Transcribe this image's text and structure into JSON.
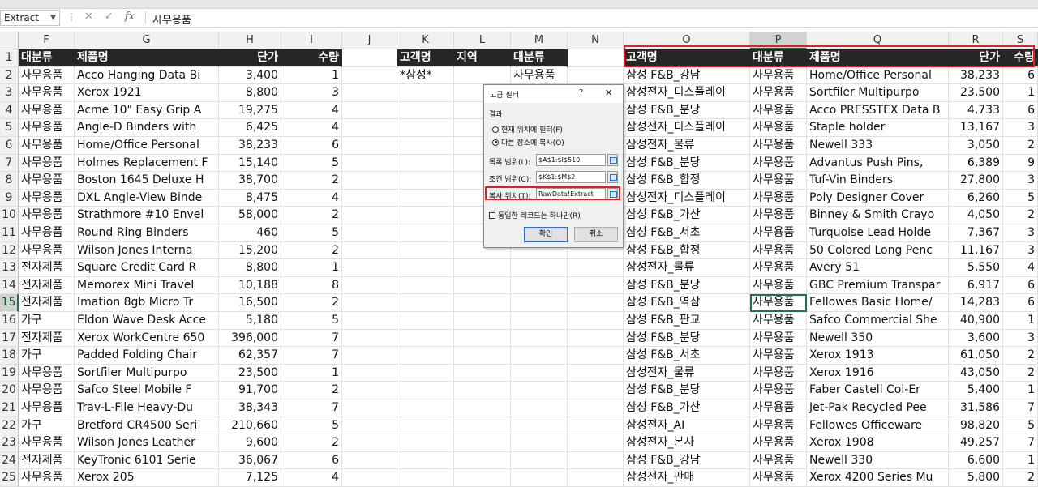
{
  "formula_bar": {
    "name_box": "Extract",
    "formula_value": "사무용품",
    "fx_label": "fx"
  },
  "columns": [
    {
      "letter": "F"
    },
    {
      "letter": "G"
    },
    {
      "letter": "H"
    },
    {
      "letter": "I"
    },
    {
      "letter": "J"
    },
    {
      "letter": "K"
    },
    {
      "letter": "L"
    },
    {
      "letter": "M"
    },
    {
      "letter": "N"
    },
    {
      "letter": "O"
    },
    {
      "letter": "P"
    },
    {
      "letter": "Q"
    },
    {
      "letter": "R"
    },
    {
      "letter": "S"
    }
  ],
  "rows": [
    "1",
    "2",
    "3",
    "4",
    "5",
    "6",
    "7",
    "8",
    "9",
    "10",
    "11",
    "12",
    "13",
    "14",
    "15",
    "16",
    "17",
    "18",
    "19",
    "20",
    "21",
    "22",
    "23",
    "24",
    "25"
  ],
  "source_headers": [
    "대분류",
    "제품명",
    "단가",
    "수량"
  ],
  "source_rows": [
    [
      "사무용품",
      "Acco Hanging Data Bi",
      "3,400",
      "1"
    ],
    [
      "사무용품",
      "Xerox 1921",
      "8,800",
      "3"
    ],
    [
      "사무용품",
      "Acme 10\" Easy Grip A",
      "19,275",
      "4"
    ],
    [
      "사무용품",
      "Angle-D Binders with",
      "6,425",
      "4"
    ],
    [
      "사무용품",
      "Home/Office Personal",
      "38,233",
      "6"
    ],
    [
      "사무용품",
      "Holmes Replacement F",
      "15,140",
      "5"
    ],
    [
      "사무용품",
      "Boston 1645 Deluxe H",
      "38,700",
      "2"
    ],
    [
      "사무용품",
      "DXL Angle-View Binde",
      "8,475",
      "4"
    ],
    [
      "사무용품",
      "Strathmore #10 Envel",
      "58,000",
      "2"
    ],
    [
      "사무용품",
      "Round Ring Binders",
      "460",
      "5"
    ],
    [
      "사무용품",
      "Wilson Jones Interna",
      "15,200",
      "2"
    ],
    [
      "전자제품",
      "Square Credit Card R",
      "8,800",
      "1"
    ],
    [
      "전자제품",
      "Memorex Mini Travel",
      "10,188",
      "8"
    ],
    [
      "전자제품",
      "Imation 8gb Micro Tr",
      "16,500",
      "2"
    ],
    [
      "가구",
      "Eldon Wave Desk Acce",
      "5,180",
      "5"
    ],
    [
      "전자제품",
      "Xerox WorkCentre 650",
      "396,000",
      "7"
    ],
    [
      "가구",
      "Padded Folding Chair",
      "62,357",
      "7"
    ],
    [
      "사무용품",
      "Sortfiler Multipurpo",
      "23,500",
      "1"
    ],
    [
      "사무용품",
      "Safco Steel Mobile F",
      "91,700",
      "2"
    ],
    [
      "사무용품",
      "Trav-L-File Heavy-Du",
      "38,343",
      "7"
    ],
    [
      "가구",
      "Bretford CR4500 Seri",
      "210,660",
      "5"
    ],
    [
      "사무용품",
      "Wilson Jones Leather",
      "9,600",
      "2"
    ],
    [
      "전자제품",
      "KeyTronic 6101 Serie",
      "36,067",
      "6"
    ],
    [
      "사무용품",
      "Xerox 205",
      "7,125",
      "4"
    ]
  ],
  "criteria": {
    "headers": [
      "고객명",
      "지역",
      "대분류"
    ],
    "values": [
      "*삼성*",
      "",
      "사무용품"
    ]
  },
  "extract_headers": [
    "고객명",
    "대분류",
    "제품명",
    "단가",
    "수량"
  ],
  "extract_rows": [
    [
      "삼성 F&B_강남",
      "사무용품",
      "Home/Office Personal",
      "38,233",
      "6"
    ],
    [
      "삼성전자_디스플레이",
      "사무용품",
      "Sortfiler Multipurpo",
      "23,500",
      "1"
    ],
    [
      "삼성 F&B_분당",
      "사무용품",
      "Acco PRESSTEX Data B",
      "4,733",
      "6"
    ],
    [
      "삼성전자_디스플레이",
      "사무용품",
      "Staple holder",
      "13,167",
      "3"
    ],
    [
      "삼성전자_물류",
      "사무용품",
      "Newell 333",
      "3,050",
      "2"
    ],
    [
      "삼성 F&B_분당",
      "사무용품",
      "Advantus Push Pins,",
      "6,389",
      "9"
    ],
    [
      "삼성 F&B_합정",
      "사무용품",
      "Tuf-Vin Binders",
      "27,800",
      "3"
    ],
    [
      "삼성전자_디스플레이",
      "사무용품",
      "Poly Designer Cover",
      "6,260",
      "5"
    ],
    [
      "삼성 F&B_가산",
      "사무용품",
      "Binney & Smith Crayo",
      "4,050",
      "2"
    ],
    [
      "삼성 F&B_서초",
      "사무용품",
      "Turquoise Lead Holde",
      "7,367",
      "3"
    ],
    [
      "삼성 F&B_합정",
      "사무용품",
      "50 Colored Long Penc",
      "11,167",
      "3"
    ],
    [
      "삼성전자_물류",
      "사무용품",
      "Avery 51",
      "5,550",
      "4"
    ],
    [
      "삼성 F&B_분당",
      "사무용품",
      "GBC Premium Transpar",
      "6,917",
      "6"
    ],
    [
      "삼성 F&B_역삼",
      "사무용품",
      "Fellowes Basic Home/",
      "14,283",
      "6"
    ],
    [
      "삼성 F&B_판교",
      "사무용품",
      "Safco Commercial She",
      "40,900",
      "1"
    ],
    [
      "삼성 F&B_분당",
      "사무용품",
      "Newell 350",
      "3,600",
      "3"
    ],
    [
      "삼성 F&B_서초",
      "사무용품",
      "Xerox 1913",
      "61,050",
      "2"
    ],
    [
      "삼성전자_물류",
      "사무용품",
      "Xerox 1916",
      "43,050",
      "2"
    ],
    [
      "삼성 F&B_분당",
      "사무용품",
      "Faber Castell Col-Er",
      "5,400",
      "1"
    ],
    [
      "삼성 F&B_가산",
      "사무용품",
      "Jet-Pak Recycled Pee",
      "31,586",
      "7"
    ],
    [
      "삼성전자_AI",
      "사무용품",
      "Fellowes Officeware",
      "98,820",
      "5"
    ],
    [
      "삼성전자_본사",
      "사무용품",
      "Xerox 1908",
      "49,257",
      "7"
    ],
    [
      "삼성 F&B_강남",
      "사무용품",
      "Newell 330",
      "6,600",
      "1"
    ],
    [
      "삼성전자_판매",
      "사무용품",
      "Xerox 4200 Series Mu",
      "5,800",
      "2"
    ]
  ],
  "dialog": {
    "title": "고급 필터",
    "help": "?",
    "close": "✕",
    "section_label": "결과",
    "radio_in_place": "현재 위치에 필터(F)",
    "radio_copy": "다른 장소에 복사(O)",
    "list_range_label": "목록 범위(L):",
    "list_range_value": "$A$1:$I$510",
    "criteria_range_label": "조건 범위(C):",
    "criteria_range_value": "$K$1:$M$2",
    "copy_to_label": "복사 위치(T):",
    "copy_to_value": "RawData!Extract",
    "unique_label": "동일한 레코드는 하나만(R)",
    "ok": "확인",
    "cancel": "취소"
  },
  "colors": {
    "header_bg": "#262626",
    "accent": "#217346",
    "highlight": "#e02020"
  }
}
